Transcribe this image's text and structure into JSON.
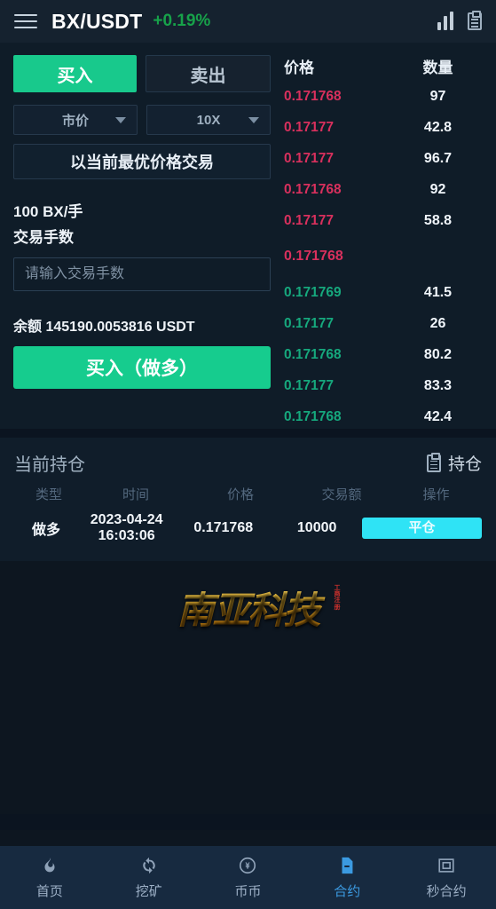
{
  "header": {
    "menu_icon": "hamburger-icon",
    "pair": "BX/USDT",
    "change": "+0.19%",
    "change_color": "#17a24a",
    "chart_icon": "bar-chart-icon",
    "orders_icon": "clipboard-icon"
  },
  "trade": {
    "buy_tab": "买入",
    "sell_tab": "卖出",
    "order_type": "市价",
    "leverage": "10X",
    "best_price_note": "以当前最优价格交易",
    "unit_line": "100 BX/手",
    "lots_label": "交易手数",
    "lots_placeholder": "请输入交易手数",
    "lots_value": "",
    "balance": "余额 145190.0053816 USDT",
    "submit": "买入（做多）",
    "accent_buy": "#16cc8e"
  },
  "orderbook": {
    "col_price": "价格",
    "col_amount": "数量",
    "ask_color": "#d8305d",
    "bid_color": "#16a87d",
    "asks": [
      {
        "price": "0.171768",
        "amount": "97"
      },
      {
        "price": "0.17177",
        "amount": "42.8"
      },
      {
        "price": "0.17177",
        "amount": "96.7"
      },
      {
        "price": "0.171768",
        "amount": "92"
      },
      {
        "price": "0.17177",
        "amount": "58.8"
      }
    ],
    "last_price": "0.171768",
    "bids": [
      {
        "price": "0.171769",
        "amount": "41.5"
      },
      {
        "price": "0.17177",
        "amount": "26"
      },
      {
        "price": "0.171768",
        "amount": "80.2"
      },
      {
        "price": "0.17177",
        "amount": "83.3"
      },
      {
        "price": "0.171768",
        "amount": "42.4"
      }
    ]
  },
  "positions": {
    "title": "当前持仓",
    "tab_label": "持仓",
    "tab_icon": "clipboard-icon",
    "columns": [
      "类型",
      "时间",
      "价格",
      "交易额",
      "操作"
    ],
    "rows": [
      {
        "type": "做多",
        "date": "2023-04-24",
        "time": "16:03:06",
        "price": "0.171768",
        "amount": "10000",
        "action": "平仓",
        "action_color": "#2fe3f5"
      }
    ]
  },
  "watermark": {
    "text": "南亚科技",
    "seal": "工商注册"
  },
  "bottom_nav": {
    "active_color": "#3b9ae1",
    "items": [
      {
        "label": "首页",
        "icon": "flame-icon"
      },
      {
        "label": "挖矿",
        "icon": "refresh-icon"
      },
      {
        "label": "币币",
        "icon": "coin-icon"
      },
      {
        "label": "合约",
        "icon": "contract-document-icon"
      },
      {
        "label": "秒合约",
        "icon": "card-icon"
      }
    ]
  }
}
